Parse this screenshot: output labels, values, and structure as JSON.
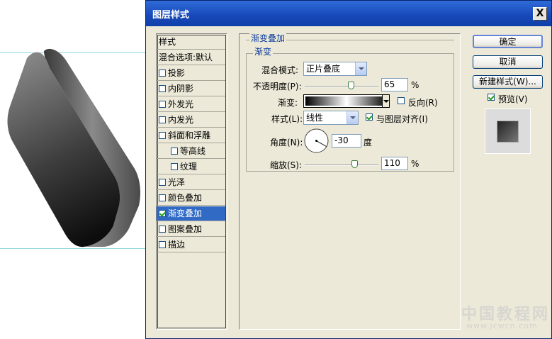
{
  "dialog": {
    "title": "图层样式",
    "close_glyph": "X"
  },
  "style_list": {
    "items": [
      {
        "label": "样式",
        "checkbox": false,
        "checked": false,
        "selected": false
      },
      {
        "label": "混合选项:默认",
        "checkbox": false,
        "checked": false,
        "selected": false
      },
      {
        "label": "投影",
        "checkbox": true,
        "checked": false,
        "selected": false
      },
      {
        "label": "内阴影",
        "checkbox": true,
        "checked": false,
        "selected": false
      },
      {
        "label": "外发光",
        "checkbox": true,
        "checked": false,
        "selected": false
      },
      {
        "label": "内发光",
        "checkbox": true,
        "checked": false,
        "selected": false
      },
      {
        "label": "斜面和浮雕",
        "checkbox": true,
        "checked": false,
        "selected": false
      },
      {
        "label": "等高线",
        "checkbox": true,
        "checked": false,
        "selected": false
      },
      {
        "label": "纹理",
        "checkbox": true,
        "checked": false,
        "selected": false
      },
      {
        "label": "光泽",
        "checkbox": true,
        "checked": false,
        "selected": false
      },
      {
        "label": "颜色叠加",
        "checkbox": true,
        "checked": false,
        "selected": false
      },
      {
        "label": "渐变叠加",
        "checkbox": true,
        "checked": true,
        "selected": true
      },
      {
        "label": "图案叠加",
        "checkbox": true,
        "checked": false,
        "selected": false
      },
      {
        "label": "描边",
        "checkbox": true,
        "checked": false,
        "selected": false
      }
    ]
  },
  "panel": {
    "section_title": "渐变叠加",
    "group_title": "渐变",
    "blend_mode_label": "混合模式:",
    "blend_mode_value": "正片叠底",
    "opacity_label": "不透明度(P):",
    "opacity_value": "65",
    "opacity_unit": "%",
    "gradient_label": "渐变:",
    "reverse_label": "反向(R)",
    "reverse_checked": false,
    "style_label": "样式(L):",
    "style_value": "线性",
    "align_label": "与图层对齐(I)",
    "align_checked": true,
    "angle_label": "角度(N):",
    "angle_value": "-30",
    "angle_unit": "度",
    "scale_label": "缩放(S):",
    "scale_value": "110",
    "scale_unit": "%"
  },
  "buttons": {
    "ok": "确定",
    "cancel": "取消",
    "new_style": "新建样式(W)...",
    "preview_label": "预览(V)",
    "preview_checked": true
  },
  "watermark": {
    "text": "中国教程网",
    "url": "www.jcwcn.com"
  },
  "colors": {
    "title_bar": "#1748b8",
    "selection": "#316ac5",
    "dialog_bg": "#ece9d8",
    "guide": "#8fd8e0"
  }
}
